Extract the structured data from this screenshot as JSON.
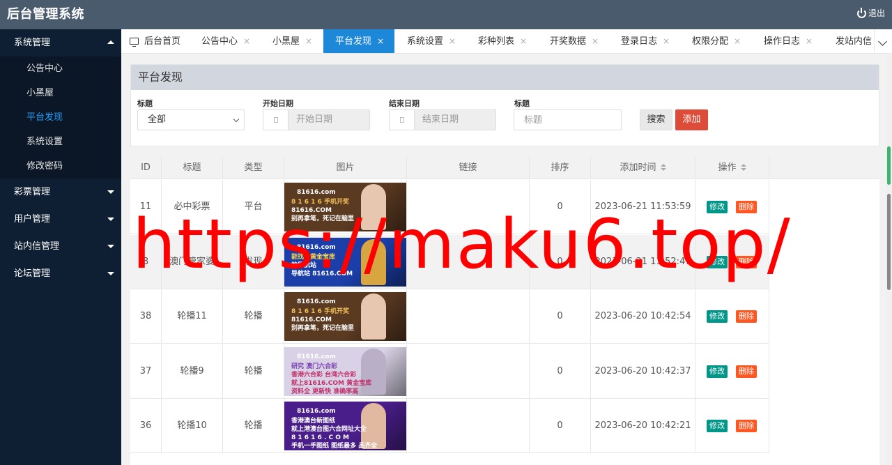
{
  "header": {
    "brand": "后台管理系统",
    "logout_label": "退出"
  },
  "sidebar": {
    "groups": [
      {
        "label": "系统管理",
        "open": true
      },
      {
        "label": "彩票管理"
      },
      {
        "label": "用户管理"
      },
      {
        "label": "站内信管理"
      },
      {
        "label": "论坛管理"
      }
    ],
    "sub_items": [
      "公告中心",
      "小黑屋",
      "平台发现",
      "系统设置",
      "修改密码"
    ],
    "active_sub": "平台发现"
  },
  "tabs": [
    {
      "label": "后台首页",
      "closable": false
    },
    {
      "label": "公告中心",
      "closable": true
    },
    {
      "label": "小黑屋",
      "closable": true
    },
    {
      "label": "平台发现",
      "closable": true,
      "active": true
    },
    {
      "label": "系统设置",
      "closable": true
    },
    {
      "label": "彩种列表",
      "closable": true
    },
    {
      "label": "开奖数据",
      "closable": true
    },
    {
      "label": "登录日志",
      "closable": true
    },
    {
      "label": "权限分配",
      "closable": true
    },
    {
      "label": "操作日志",
      "closable": true
    },
    {
      "label": "发站内信",
      "closable": false
    }
  ],
  "close_glyph": "×",
  "panel": {
    "title": "平台发现",
    "filters": {
      "title_label": "标题",
      "title_select_value": "全部",
      "start_label": "开始日期",
      "start_placeholder": "开始日期",
      "end_label": "结束日期",
      "end_placeholder": "结束日期",
      "keyword_label": "标题",
      "keyword_placeholder": "标题"
    },
    "search_label": "搜索",
    "add_label": "添加"
  },
  "table": {
    "columns": [
      "ID",
      "标题",
      "类型",
      "图片",
      "链接",
      "排序",
      "添加时间",
      "操作"
    ],
    "rows": [
      {
        "id": "11",
        "title": "必中彩票",
        "type": "平台",
        "link": "",
        "sort": "0",
        "time": "2023-06-21 11:53:59",
        "banner": {
          "brand": "81616.com",
          "lines": [
            "8 1 6 1 6 手机开奖",
            "81616.COM",
            "别再拿笔，死记在脑里"
          ],
          "bg": "#5b3a22",
          "accent": "#f3c25a",
          "figure": "#e8c7b0"
        }
      },
      {
        "id": "8",
        "title": "澳门管家婆",
        "type": "发现",
        "link": "",
        "sort": "0",
        "time": "2023-06-21 11:52:47",
        "banner": {
          "brand": "81616.com",
          "lines": [
            "能找到黄金宝库",
            "的导航站",
            "导航站 81616.COM"
          ],
          "bg": "#1b3ea8",
          "accent": "#ffd54a",
          "figure": "#d8a640"
        }
      },
      {
        "id": "38",
        "title": "轮播11",
        "type": "轮播",
        "link": "",
        "sort": "0",
        "time": "2023-06-20 10:42:54",
        "banner": {
          "brand": "81616.com",
          "lines": [
            "8 1 6 1 6 手机开奖",
            "81616.COM",
            "别再拿笔，死记在脑里"
          ],
          "bg": "#5b3a22",
          "accent": "#f3c25a",
          "figure": "#e8c7b0"
        }
      },
      {
        "id": "37",
        "title": "轮播9",
        "type": "轮播",
        "link": "",
        "sort": "0",
        "time": "2023-06-20 10:42:37",
        "banner": {
          "brand": "81616.com",
          "lines": [
            "研究 澳门六合彩",
            "香港六合彩 台湾六合彩",
            "就上81616.COM 黄金宝库",
            "资料全 更新快 准确率高"
          ],
          "bg": "#d9d2e6",
          "accent": "#7b3fb3",
          "figure": "#b9b0c8"
        }
      },
      {
        "id": "36",
        "title": "轮播10",
        "type": "轮播",
        "link": "",
        "sort": "0",
        "time": "2023-06-20 10:42:21",
        "banner": {
          "brand": "81616.com",
          "lines": [
            "香港澳台新图纸",
            "就上港澳台图六合网址大全",
            "8 1 6 1 6 . C O M",
            "手机一手图纸 图纸最多 品齐全"
          ],
          "bg": "#4a1e8a",
          "accent": "#ffffff",
          "figure": "#e0b9a0"
        }
      }
    ],
    "edit_label": "修改",
    "delete_label": "删除"
  },
  "watermark": "https://maku6.top/"
}
